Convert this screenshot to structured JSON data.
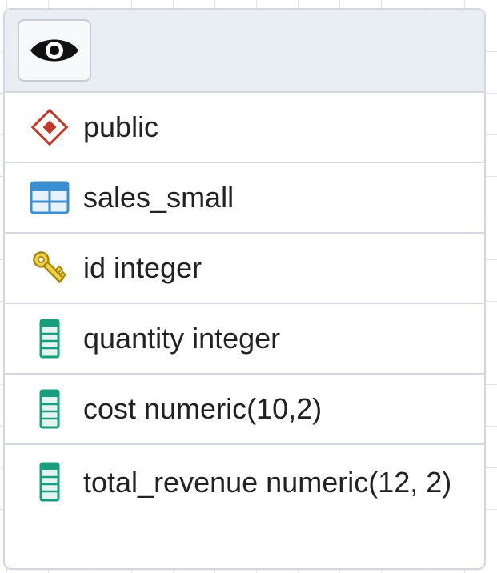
{
  "table_node": {
    "header": {
      "view_button_icon": "eye-icon"
    },
    "rows": [
      {
        "icon": "schema-icon",
        "label": "public"
      },
      {
        "icon": "table-icon",
        "label": "sales_small"
      },
      {
        "icon": "primary-key-icon",
        "label": "id integer"
      },
      {
        "icon": "column-icon",
        "label": "quantity integer"
      },
      {
        "icon": "column-icon",
        "label": "cost numeric(10,2)"
      },
      {
        "icon": "column-icon",
        "label": "total_revenue numeric(12, 2)"
      }
    ]
  },
  "colors": {
    "schema_icon": "#c0392b",
    "table_icon": "#3b8fd1",
    "key_icon": "#e8c02a",
    "column_icon": "#1a9c7e",
    "header_bg": "#e9eef4",
    "border": "#d4d8de"
  }
}
